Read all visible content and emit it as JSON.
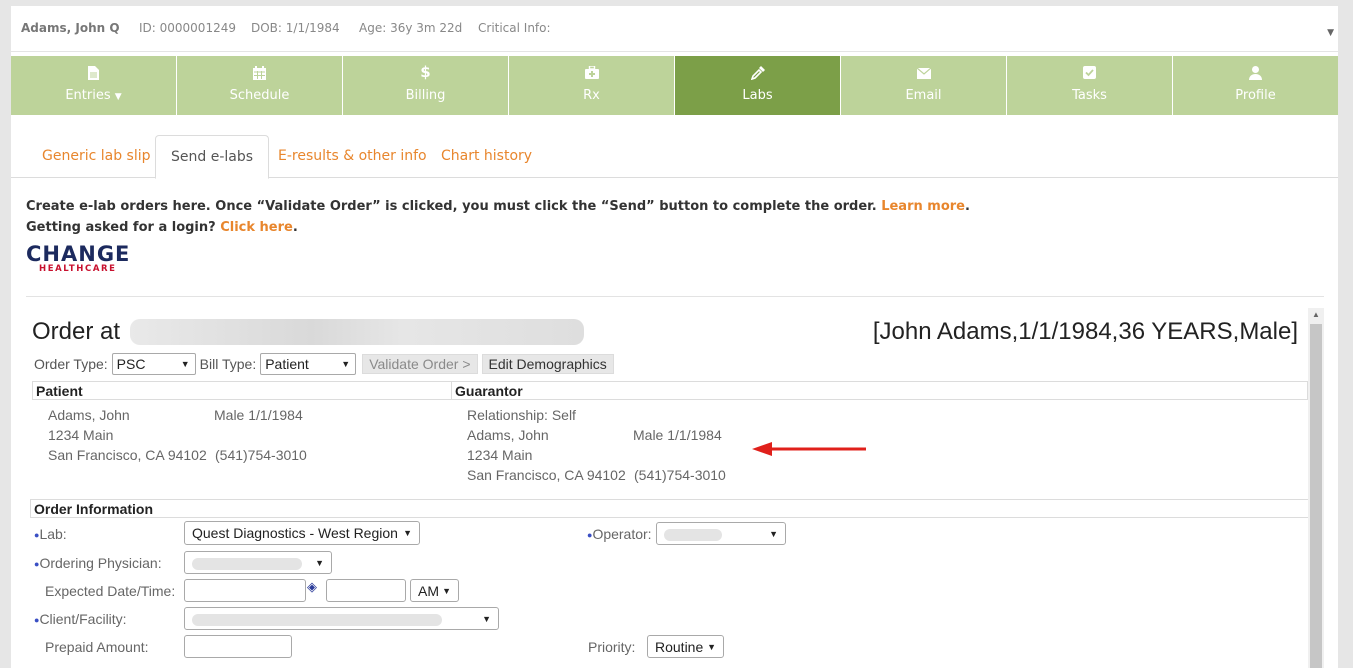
{
  "patient_header": {
    "name": "Adams, John Q",
    "id": "ID: 0000001249",
    "dob": "DOB: 1/1/1984",
    "age": "Age: 36y 3m 22d",
    "critical": "Critical Info:"
  },
  "nav": {
    "items": [
      {
        "label": "Entries",
        "icon": "file-icon",
        "dropdown": true
      },
      {
        "label": "Schedule",
        "icon": "calendar-icon"
      },
      {
        "label": "Billing",
        "icon": "dollar-icon"
      },
      {
        "label": "Rx",
        "icon": "medkit-icon"
      },
      {
        "label": "Labs",
        "icon": "eyedropper-icon",
        "active": true
      },
      {
        "label": "Email",
        "icon": "envelope-icon"
      },
      {
        "label": "Tasks",
        "icon": "check-square-icon"
      },
      {
        "label": "Profile",
        "icon": "user-icon"
      }
    ],
    "active_color": "#7c9f48",
    "color": "#bdd39a"
  },
  "tabs": [
    {
      "label": "Generic lab slip"
    },
    {
      "label": "Send e-labs",
      "active": true
    },
    {
      "label": "E-results & other info"
    },
    {
      "label": "Chart history"
    }
  ],
  "intro": {
    "line1": "Create e-lab orders here. Once “Validate Order” is clicked, you must click the “Send” button to complete the order.",
    "learn_more": "Learn more",
    "line2": "Getting asked for a login?",
    "click_here": "Click here"
  },
  "logo": {
    "main": "CHANGE",
    "sub": "HEALTHCARE"
  },
  "order": {
    "title": "Order at",
    "patient_summary": "[John Adams,1/1/1984,36 YEARS,Male]",
    "order_type_label": "Order Type:",
    "order_type_value": "PSC",
    "bill_type_label": "Bill Type:",
    "bill_type_value": "Patient",
    "validate_button": "Validate Order >",
    "edit_button": "Edit Demographics",
    "patient_section": "Patient",
    "guarantor_section": "Guarantor",
    "patient": {
      "name": "Adams, John",
      "sex_dob": "Male  1/1/1984",
      "street": "1234 Main",
      "city": "San Francisco, CA 94102",
      "phone": "(541)754-3010"
    },
    "guarantor": {
      "relationship": "Relationship:  Self",
      "name": "Adams, John",
      "sex_dob": "Male  1/1/1984",
      "street": "1234 Main",
      "city": "San Francisco, CA 94102",
      "phone": "(541)754-3010"
    },
    "order_info_section": "Order Information",
    "lab_label": "Lab:",
    "lab_value": "Quest Diagnostics - West Region",
    "operator_label": "Operator:",
    "physician_label": "Ordering Physician:",
    "expected_label": "Expected Date/Time:",
    "ampm_value": "AM",
    "client_label": "Client/Facility:",
    "prepaid_label": "Prepaid Amount:",
    "priority_label": "Priority:",
    "priority_value": "Routine"
  },
  "annotation_color": "#e0201b"
}
